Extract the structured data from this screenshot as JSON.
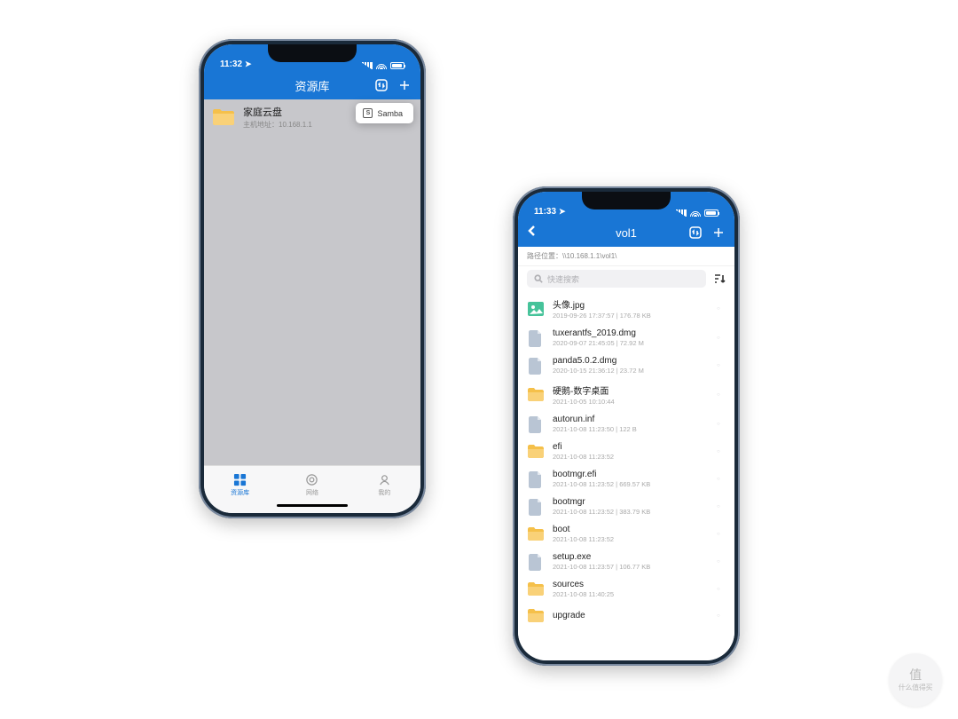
{
  "watermark": {
    "brand_top": "值",
    "brand": "什么值得买"
  },
  "phone_left": {
    "status": {
      "time": "11:32",
      "loc_icon": "location"
    },
    "nav": {
      "title": "资源库"
    },
    "library_item": {
      "title": "家庭云盘",
      "subtitle_label": "主机地址：",
      "subtitle_value": "10.168.1.1"
    },
    "dropdown": {
      "label": "Samba",
      "icon_letter": "S"
    },
    "tabs": [
      {
        "key": "library",
        "label": "资源库",
        "active": true
      },
      {
        "key": "network",
        "label": "网络",
        "active": false
      },
      {
        "key": "mine",
        "label": "我的",
        "active": false
      }
    ]
  },
  "phone_right": {
    "status": {
      "time": "11:33",
      "loc_icon": "location"
    },
    "nav": {
      "title": "vol1"
    },
    "path": {
      "label": "路径位置：",
      "value": "\\\\10.168.1.1\\vol1\\"
    },
    "search": {
      "placeholder": "快速搜索"
    },
    "files": [
      {
        "type": "image",
        "name": "头像.jpg",
        "meta": "2019-09-26 17:37:57 | 176.78 KB"
      },
      {
        "type": "file",
        "name": "tuxerantfs_2019.dmg",
        "meta": "2020-09-07 21:45:05 | 72.92 M"
      },
      {
        "type": "file",
        "name": "panda5.0.2.dmg",
        "meta": "2020-10-15 21:36:12 | 23.72 M"
      },
      {
        "type": "folder",
        "name": "硬鹅-数字桌面",
        "meta": "2021-10-05 10:10:44"
      },
      {
        "type": "file",
        "name": "autorun.inf",
        "meta": "2021-10-08 11:23:50 | 122 B"
      },
      {
        "type": "folder",
        "name": "efi",
        "meta": "2021-10-08 11:23:52"
      },
      {
        "type": "file",
        "name": "bootmgr.efi",
        "meta": "2021-10-08 11:23:52 | 669.57 KB"
      },
      {
        "type": "file",
        "name": "bootmgr",
        "meta": "2021-10-08 11:23:52 | 383.79 KB"
      },
      {
        "type": "folder",
        "name": "boot",
        "meta": "2021-10-08 11:23:52"
      },
      {
        "type": "file",
        "name": "setup.exe",
        "meta": "2021-10-08 11:23:57 | 106.77 KB"
      },
      {
        "type": "folder",
        "name": "sources",
        "meta": "2021-10-08 11:40:25"
      },
      {
        "type": "folder",
        "name": "upgrade",
        "meta": ""
      }
    ]
  }
}
